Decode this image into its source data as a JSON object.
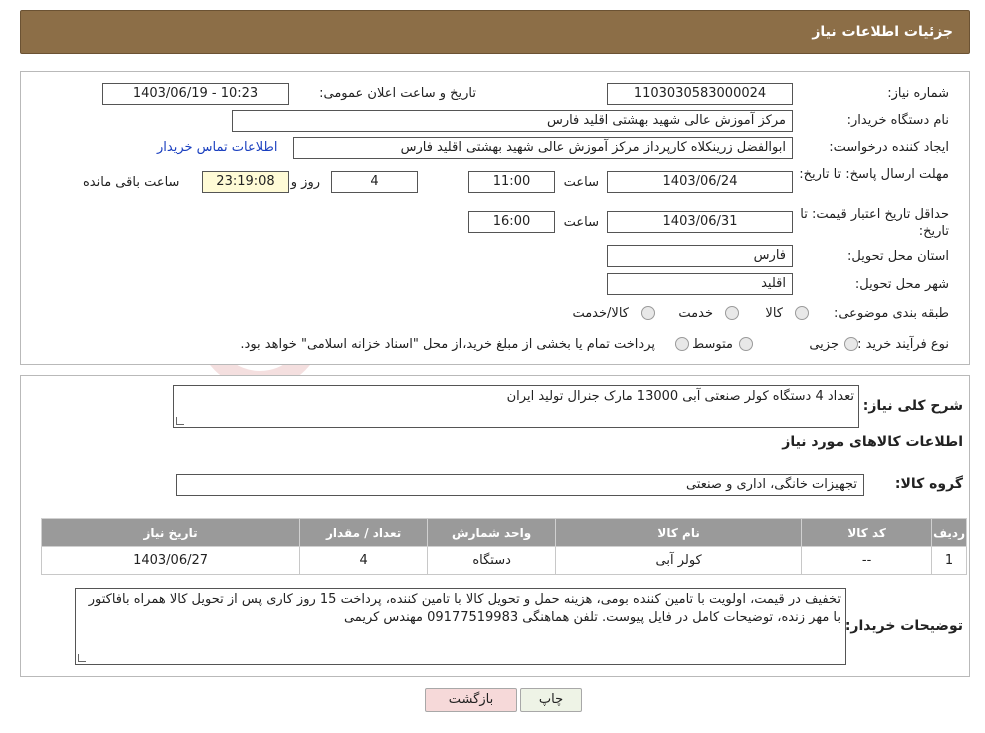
{
  "header": {
    "title": "جزئیات اطلاعات نیاز"
  },
  "details": {
    "need_number_label": "شماره نیاز:",
    "need_number": "1103030583000024",
    "announce_label": "تاریخ و ساعت اعلان عمومی:",
    "announce_value": "1403/06/19 - 10:23",
    "buyer_label": "نام دستگاه خریدار:",
    "buyer_value": "مرکز آموزش عالی شهید بهشتی اقلید فارس",
    "creator_label": "ایجاد کننده درخواست:",
    "creator_value": "ابوالفضل زرینکلاه کارپرداز مرکز آموزش عالی شهید بهشتی اقلید فارس",
    "contact_link": "اطلاعات تماس خریدار",
    "deadline_label": "مهلت ارسال پاسخ: تا تاریخ:",
    "deadline_date": "1403/06/24",
    "time_label": "ساعت",
    "deadline_time": "11:00",
    "days_value": "4",
    "days_label": "روز و",
    "remaining_time": "23:19:08",
    "remaining_label": "ساعت باقی مانده",
    "validity_label": "حداقل تاریخ اعتبار قیمت: تا تاریخ:",
    "validity_date": "1403/06/31",
    "validity_time": "16:00",
    "province_label": "استان محل تحویل:",
    "province_value": "فارس",
    "city_label": "شهر محل تحویل:",
    "city_value": "اقلید",
    "category_label": "طبقه بندی موضوعی:",
    "category_options": [
      "کالا",
      "خدمت",
      "کالا/خدمت"
    ],
    "process_label": "نوع فرآیند خرید :",
    "process_options": [
      "جزیی",
      "متوسط"
    ],
    "process_note": "پرداخت تمام یا بخشی از مبلغ خرید،از محل \"اسناد خزانه اسلامی\" خواهد بود."
  },
  "goods": {
    "summary_label": "شرح کلی نیاز:",
    "summary_value": "تعداد 4 دستگاه کولر صنعتی آبی 13000 مارک جنرال تولید ایران",
    "section_title": "اطلاعات کالاهای مورد نیاز",
    "group_label": "گروه کالا:",
    "group_value": "تجهیزات خانگی، اداری و صنعتی",
    "table": {
      "headers": [
        "ردیف",
        "کد کالا",
        "نام کالا",
        "واحد شمارش",
        "تعداد / مقدار",
        "تاریخ نیاز"
      ],
      "rows": [
        [
          "1",
          "--",
          "کولر آبی",
          "دستگاه",
          "4",
          "1403/06/27"
        ]
      ]
    },
    "buyer_notes_label": "توضیحات خریدار:",
    "buyer_notes_value": "تخفیف در قیمت، اولویت با تامین کننده بومی، هزینه حمل و تحویل کالا با تامین کننده، پرداخت 15 روز کاری  پس از تحویل کالا همراه بافاکتور با مهر زنده، توضیحات کامل در فایل پیوست. تلفن هماهنگی 09177519983 مهندس کریمی"
  },
  "buttons": {
    "print": "چاپ",
    "back": "بازگشت"
  },
  "colors": {
    "header": "#8c6e47",
    "back_button": "#f6d9d9",
    "print_button": "#eef3e6",
    "link": "#1a3fbf"
  }
}
